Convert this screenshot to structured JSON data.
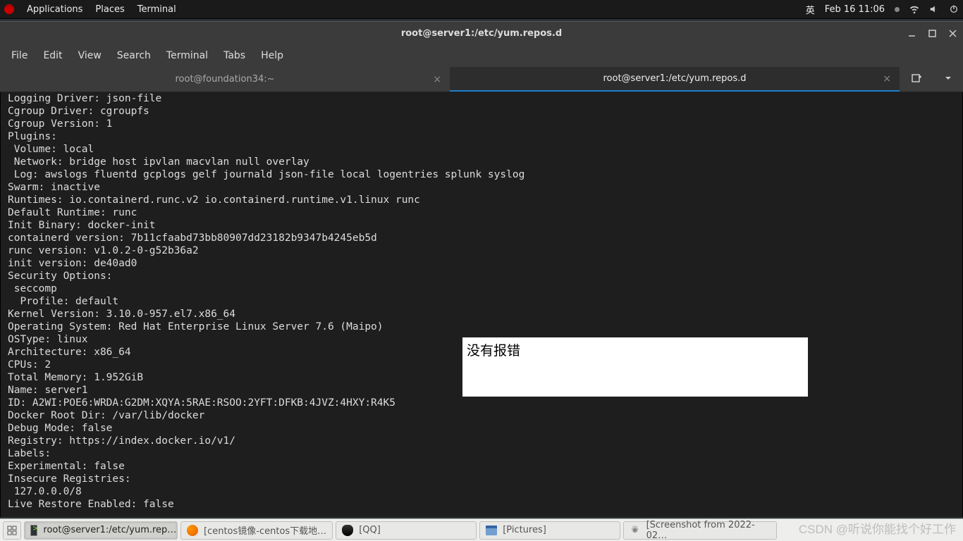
{
  "topbar": {
    "applications": "Applications",
    "places": "Places",
    "terminal": "Terminal",
    "ime": "英",
    "clock": "Feb 16  11:06"
  },
  "window": {
    "title": "root@server1:/etc/yum.repos.d",
    "menus": {
      "file": "File",
      "edit": "Edit",
      "view": "View",
      "search": "Search",
      "terminal": "Terminal",
      "tabs": "Tabs",
      "help": "Help"
    },
    "tabs": [
      {
        "label": "root@foundation34:~",
        "active": false
      },
      {
        "label": "root@server1:/etc/yum.repos.d",
        "active": true
      }
    ]
  },
  "terminal_output": "Logging Driver: json-file\nCgroup Driver: cgroupfs\nCgroup Version: 1\nPlugins:\n Volume: local\n Network: bridge host ipvlan macvlan null overlay\n Log: awslogs fluentd gcplogs gelf journald json-file local logentries splunk syslog\nSwarm: inactive\nRuntimes: io.containerd.runc.v2 io.containerd.runtime.v1.linux runc\nDefault Runtime: runc\nInit Binary: docker-init\ncontainerd version: 7b11cfaabd73bb80907dd23182b9347b4245eb5d\nrunc version: v1.0.2-0-g52b36a2\ninit version: de40ad0\nSecurity Options:\n seccomp\n  Profile: default\nKernel Version: 3.10.0-957.el7.x86_64\nOperating System: Red Hat Enterprise Linux Server 7.6 (Maipo)\nOSType: linux\nArchitecture: x86_64\nCPUs: 2\nTotal Memory: 1.952GiB\nName: server1\nID: A2WI:POE6:WRDA:G2DM:XQYA:5RAE:RSOO:2YFT:DFKB:4JVZ:4HXY:R4K5\nDocker Root Dir: /var/lib/docker\nDebug Mode: false\nRegistry: https://index.docker.io/v1/\nLabels:\nExperimental: false\nInsecure Registries:\n 127.0.0.0/8\nLive Restore Enabled: false",
  "annotation": {
    "text": "没有报错"
  },
  "taskbar": {
    "items": [
      {
        "label": "root@server1:/etc/yum.rep…",
        "icon": "terminal",
        "active": true
      },
      {
        "label": "[centos镜像-centos下载地…",
        "icon": "firefox",
        "active": false
      },
      {
        "label": "[QQ]",
        "icon": "penguin",
        "active": false
      },
      {
        "label": "[Pictures]",
        "icon": "folder",
        "active": false
      },
      {
        "label": "[Screenshot from 2022-02…",
        "icon": "gear",
        "active": false
      }
    ]
  },
  "watermark": "CSDN @听说你能找个好工作"
}
